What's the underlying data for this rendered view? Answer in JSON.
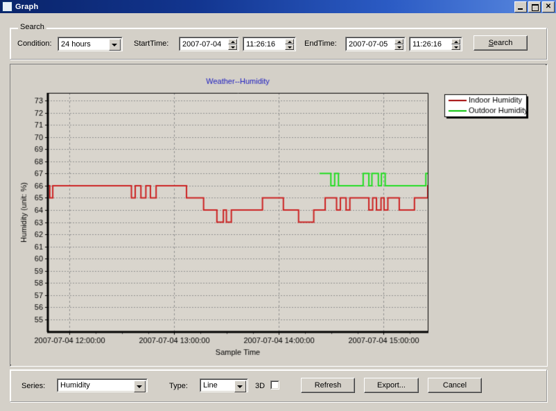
{
  "window": {
    "title": "Graph",
    "icon": "graph-window-icon",
    "buttons": {
      "minimize": "_",
      "maximize": "□",
      "close": "✕"
    }
  },
  "search": {
    "group_label": "Search",
    "condition_label": "Condition:",
    "condition_value": "24 hours",
    "condition_options": [
      "24 hours"
    ],
    "starttime_label": "StartTime:",
    "starttime_date": "2007-07-04",
    "starttime_time": "11:26:16",
    "endtime_label": "EndTime:",
    "endtime_date": "2007-07-05",
    "endtime_time": "11:26:16",
    "search_button": "Search",
    "search_button_accel": "S"
  },
  "footer": {
    "series_label": "Series:",
    "series_value": "Humidity",
    "series_options": [
      "Humidity"
    ],
    "type_label": "Type:",
    "type_value": "Line",
    "type_options": [
      "Line"
    ],
    "threed_label": "3D",
    "threed_checked": false,
    "refresh_button": "Refresh",
    "export_button": "Export...",
    "cancel_button": "Cancel"
  },
  "chart_data": {
    "type": "line",
    "title": "Weather--Humidity",
    "title_color": "#2020c0",
    "xlabel": "Sample Time",
    "ylabel": "Humidity (unit: %)",
    "grid": true,
    "legend_position": "right-top",
    "plot_bg": "#d9d5cd",
    "ylim": [
      55,
      73
    ],
    "yticks": [
      55,
      56,
      57,
      58,
      59,
      60,
      61,
      62,
      63,
      64,
      65,
      66,
      67,
      68,
      69,
      70,
      71,
      72,
      73
    ],
    "xlim": [
      0,
      100
    ],
    "xticks": [
      5.6,
      33.2,
      60.8,
      88.4
    ],
    "xticklabels": [
      "2007-07-04 12:00:00",
      "2007-07-04 13:00:00",
      "2007-07-04 14:00:00",
      "2007-07-04 15:00:00"
    ],
    "xminorticks": [
      12.5,
      19.5,
      26.4,
      40.1,
      47.0,
      54.0,
      67.7,
      74.6,
      81.5,
      95.3
    ],
    "series": [
      {
        "name": "Indoor Humidity",
        "color": "#cc2222",
        "legend_color": "#a00000",
        "step": true,
        "points": [
          [
            0.0,
            66
          ],
          [
            0.5,
            66
          ],
          [
            0.5,
            65
          ],
          [
            1.3,
            65
          ],
          [
            1.3,
            66
          ],
          [
            22.0,
            66
          ],
          [
            22.0,
            65
          ],
          [
            23.0,
            65
          ],
          [
            23.0,
            66
          ],
          [
            24.5,
            66
          ],
          [
            24.5,
            65
          ],
          [
            25.8,
            65
          ],
          [
            25.8,
            66
          ],
          [
            27.0,
            66
          ],
          [
            27.0,
            65
          ],
          [
            28.5,
            65
          ],
          [
            28.5,
            66
          ],
          [
            36.5,
            66
          ],
          [
            36.5,
            65
          ],
          [
            41.0,
            65
          ],
          [
            41.0,
            64
          ],
          [
            44.5,
            64
          ],
          [
            44.5,
            63
          ],
          [
            46.2,
            63
          ],
          [
            46.2,
            64
          ],
          [
            47.0,
            64
          ],
          [
            47.0,
            63
          ],
          [
            48.3,
            63
          ],
          [
            48.3,
            64
          ],
          [
            56.5,
            64
          ],
          [
            56.5,
            65
          ],
          [
            62.0,
            65
          ],
          [
            62.0,
            64
          ],
          [
            66.0,
            64
          ],
          [
            66.0,
            63
          ],
          [
            70.0,
            63
          ],
          [
            70.0,
            64
          ],
          [
            73.0,
            64
          ],
          [
            73.0,
            65
          ],
          [
            76.0,
            65
          ],
          [
            76.0,
            64
          ],
          [
            77.0,
            64
          ],
          [
            77.0,
            65
          ],
          [
            78.5,
            65
          ],
          [
            78.5,
            64
          ],
          [
            79.5,
            64
          ],
          [
            79.5,
            65
          ],
          [
            84.5,
            65
          ],
          [
            84.5,
            64
          ],
          [
            85.5,
            64
          ],
          [
            85.5,
            65
          ],
          [
            86.5,
            65
          ],
          [
            86.5,
            64
          ],
          [
            87.7,
            64
          ],
          [
            87.7,
            65
          ],
          [
            88.5,
            65
          ],
          [
            88.5,
            64
          ],
          [
            89.5,
            64
          ],
          [
            89.5,
            65
          ],
          [
            92.5,
            65
          ],
          [
            92.5,
            64
          ],
          [
            96.5,
            64
          ],
          [
            96.5,
            65
          ],
          [
            100.0,
            65
          ],
          [
            100.0,
            66
          ],
          [
            106.0,
            66
          ]
        ]
      },
      {
        "name": "Outdoor Humidity",
        "color": "#22dd22",
        "legend_color": "#00c000",
        "step": true,
        "points": [
          [
            71.5,
            67
          ],
          [
            74.5,
            67
          ],
          [
            74.5,
            66
          ],
          [
            75.5,
            66
          ],
          [
            75.5,
            67
          ],
          [
            76.5,
            67
          ],
          [
            76.5,
            66
          ],
          [
            83.0,
            66
          ],
          [
            83.0,
            67
          ],
          [
            84.5,
            67
          ],
          [
            84.5,
            66
          ],
          [
            85.3,
            66
          ],
          [
            85.3,
            67
          ],
          [
            87.0,
            67
          ],
          [
            87.0,
            66
          ],
          [
            87.8,
            66
          ],
          [
            87.8,
            67
          ],
          [
            88.8,
            67
          ],
          [
            88.8,
            66
          ],
          [
            99.5,
            66
          ],
          [
            99.5,
            67
          ],
          [
            106.0,
            67
          ]
        ]
      }
    ]
  }
}
